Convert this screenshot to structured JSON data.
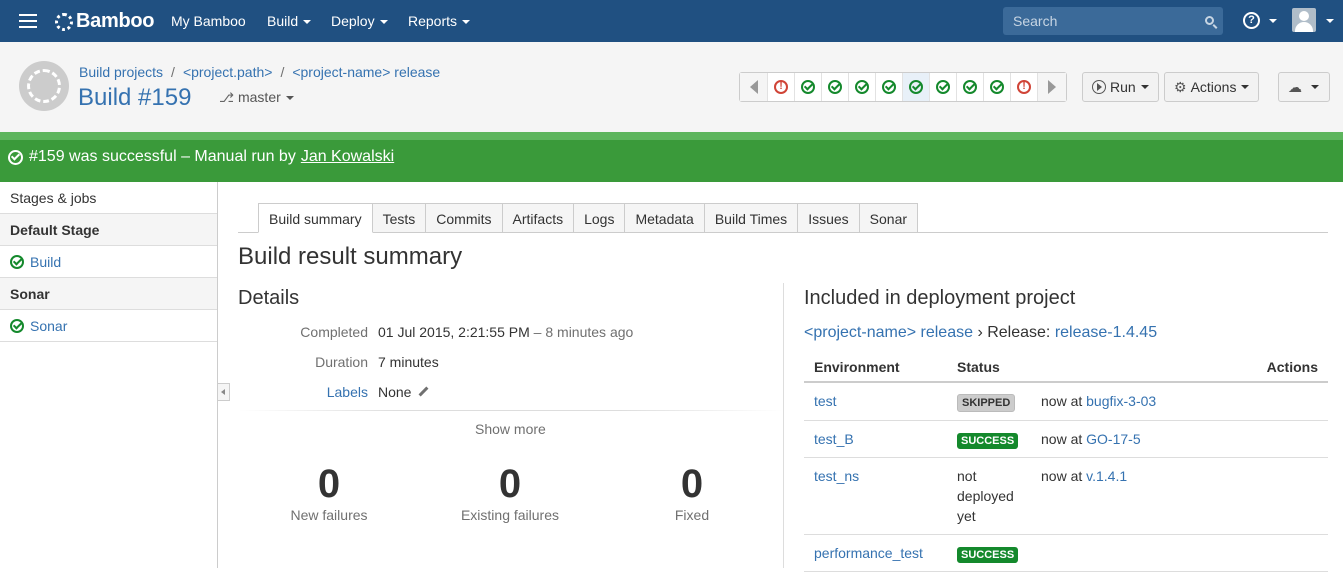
{
  "nav": {
    "logo": "Bamboo",
    "items": [
      "My Bamboo",
      "Build",
      "Deploy",
      "Reports"
    ],
    "search_placeholder": "Search"
  },
  "header": {
    "breadcrumbs": [
      "Build projects",
      "<project.path>",
      "<project-name> release"
    ],
    "title": "Build #159",
    "branch": "master",
    "history": [
      "error",
      "ok",
      "ok",
      "ok",
      "ok",
      "ok",
      "ok",
      "ok",
      "ok",
      "error"
    ],
    "run_label": "Run",
    "actions_label": "Actions"
  },
  "status": {
    "prefix": "#159 was successful – Manual run by",
    "user": "Jan Kowalski",
    "color": "#3a9a3a"
  },
  "sidebar": {
    "title": "Stages & jobs",
    "stages": [
      {
        "name": "Default Stage",
        "job": "Build"
      },
      {
        "name": "Sonar",
        "job": "Sonar"
      }
    ]
  },
  "tabs": [
    "Build summary",
    "Tests",
    "Commits",
    "Artifacts",
    "Logs",
    "Metadata",
    "Build Times",
    "Issues",
    "Sonar"
  ],
  "summary": {
    "title": "Build result summary",
    "details_title": "Details",
    "completed_label": "Completed",
    "completed_value": "01 Jul 2015, 2:21:55 PM",
    "completed_ago": "8 minutes ago",
    "duration_label": "Duration",
    "duration_value": "7 minutes",
    "labels_label": "Labels",
    "labels_value": "None",
    "show_more": "Show more",
    "stats": [
      {
        "value": "0",
        "label": "New failures"
      },
      {
        "value": "0",
        "label": "Existing failures"
      },
      {
        "value": "0",
        "label": "Fixed"
      }
    ]
  },
  "deployment": {
    "title": "Included in deployment project",
    "project_link": "<project-name> release",
    "release_prefix": "› Release:",
    "release_link": "release-1.4.45",
    "columns": [
      "Environment",
      "Status",
      "",
      "Actions"
    ],
    "rows": [
      {
        "env": "test",
        "status": "SKIPPED",
        "status_type": "skipped",
        "now_prefix": "now at",
        "now_link": "bugfix-3-03"
      },
      {
        "env": "test_B",
        "status": "SUCCESS",
        "status_type": "success",
        "now_prefix": "now at",
        "now_link": "GO-17-5"
      },
      {
        "env": "test_ns",
        "status": "not deployed yet",
        "status_type": "text",
        "now_prefix": "now at",
        "now_link": "v.1.4.1"
      },
      {
        "env": "performance_test",
        "status": "SUCCESS",
        "status_type": "success",
        "now_prefix": "",
        "now_link": ""
      }
    ]
  }
}
